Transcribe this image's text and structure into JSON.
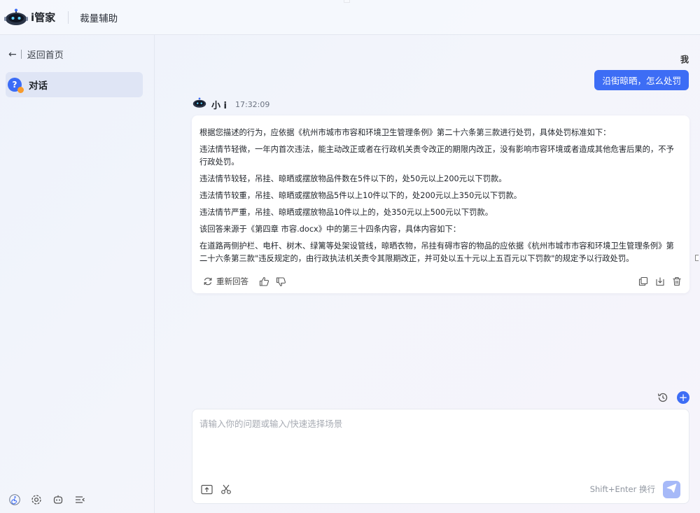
{
  "header": {
    "app_name": "i管家",
    "tab_label": "裁量辅助"
  },
  "sidebar": {
    "back_label": "返回首页",
    "nav_items": [
      {
        "label": "对话",
        "active": true,
        "icon": "chat-question-icon"
      }
    ],
    "bottom_icons": [
      "accessibility-icon",
      "settings-icon",
      "robot-icon",
      "collapse-menu-icon"
    ]
  },
  "conversation": {
    "user_name": "我",
    "user_message": "沿街晾晒，怎么处罚",
    "bot_name": "小 i",
    "bot_time": "17:32:09",
    "answer_paragraphs": [
      "根据您描述的行为，应依据《杭州市城市市容和环境卫生管理条例》第二十六条第三款进行处罚，具体处罚标准如下：",
      "违法情节轻微，一年内首次违法，能主动改正或者在行政机关责令改正的期限内改正，没有影响市容环境或者造成其他危害后果的，不予行政处罚。",
      "违法情节较轻，吊挂、晾晒或摆放物品件数在5件以下的，处50元以上200元以下罚款。",
      "违法情节较重，吊挂、晾晒或摆放物品5件以上10件以下的，处200元以上350元以下罚款。",
      "违法情节严重，吊挂、晾晒或摆放物品10件以上的，处350元以上500元以下罚款。",
      "该回答来源于《第四章 市容.docx》中的第三十四条内容，具体内容如下：",
      "在道路两侧护栏、电杆、树木、绿篱等处架设管线，晾晒衣物，吊挂有碍市容的物品的应依据《杭州市城市市容和环境卫生管理条例》第二十六条第三款\"违反规定的，由行政执法机关责令其限期改正，并可处以五十元以上五百元以下罚款\"的规定予以行政处罚。"
    ],
    "regenerate_label": "重新回答",
    "action_icons": [
      "refresh-icon",
      "thumbs-up-icon",
      "thumbs-down-icon",
      "copy-icon",
      "download-icon",
      "delete-icon"
    ]
  },
  "composer": {
    "placeholder": "请输入你的问题或输入/快速选择场景",
    "value": "",
    "hint": "Shift+Enter 换行",
    "tool_icons": [
      "upload-icon",
      "scissors-icon",
      "send-icon",
      "history-icon",
      "new-chat-icon"
    ]
  },
  "colors": {
    "accent": "#3d6df5",
    "send_disabled": "#a6b9f8",
    "active_nav_bg": "#dfe5f5"
  }
}
